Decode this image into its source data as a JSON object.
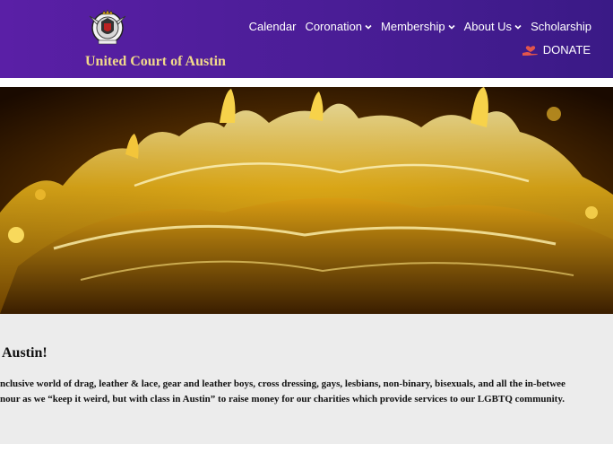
{
  "header": {
    "site_title": "United Court of Austin",
    "nav": [
      {
        "label": "Calendar",
        "has_dropdown": false
      },
      {
        "label": "Coronation",
        "has_dropdown": true
      },
      {
        "label": "Membership",
        "has_dropdown": true
      },
      {
        "label": "About Us",
        "has_dropdown": true
      },
      {
        "label": "Scholarship",
        "has_dropdown": false
      }
    ],
    "donate_label": "DONATE",
    "donate_icon": "hand-heart-icon",
    "colors": {
      "header_bg": "#4a1d96",
      "title": "#f1d98a",
      "donate_icon": "#e2554b"
    }
  },
  "intro": {
    "welcome": "Austin!",
    "line1": "nclusive world of drag, leather & lace, gear and leather boys, cross dressing, gays, lesbians, non-binary, bisexuals, and all the in-betwee",
    "line2": "nour as we “keep it weird, but with class in Austin” to raise money for our charities which provide services to our LGBTQ community."
  }
}
